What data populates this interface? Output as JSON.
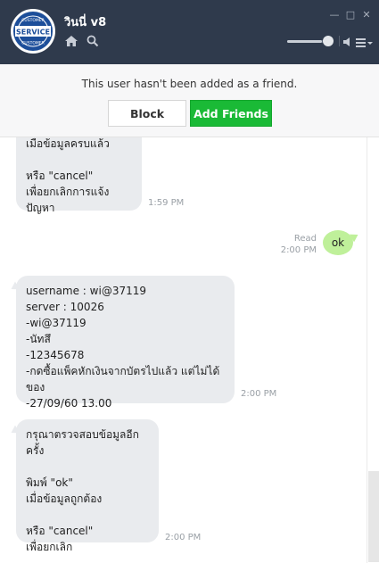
{
  "header": {
    "title": "วินนี่ v8",
    "avatar_text": "SERVICE",
    "avatar_ring_text": "CUSTOMER",
    "window_buttons": {
      "minimize": "—",
      "maximize": "□",
      "close": "✕"
    },
    "volume_level": 0.85
  },
  "notice": {
    "text": "This user hasn't been added as a friend.",
    "block_label": "Block",
    "add_friends_label": "Add Friends"
  },
  "messages": [
    {
      "direction": "in",
      "text": "เมื่อข้อมูลครบแล้ว\n\nหรือ \"cancel\"\nเพื่อยกเลิกการแจ้งปัญหา",
      "time": "1:59 PM"
    },
    {
      "direction": "out",
      "text": "ok",
      "read": "Read",
      "time": "2:00 PM"
    },
    {
      "direction": "in",
      "text": "username : wi@37119\nserver : 10026\n-wi@37119\n-นัทสึ\n-12345678\n-กดซื้อแพ็คหักเงินจากบัตรไปแล้ว แต่ไม่ได้ของ\n-27/09/60 13.00",
      "time": "2:00 PM"
    },
    {
      "direction": "in",
      "text": "กรุณาตรวจสอบข้อมูลอีกครั้ง\n\nพิมพ์ \"ok\"\nเมื่อข้อมูลถูกต้อง\n\nหรือ \"cancel\"\nเพื่อยกเลิก",
      "time": "2:00 PM"
    }
  ],
  "colors": {
    "header_bg": "#2f3a4c",
    "add_friends_green": "#1aba36",
    "incoming_bubble": "#e9ebee",
    "outgoing_bubble": "#bff09a"
  }
}
